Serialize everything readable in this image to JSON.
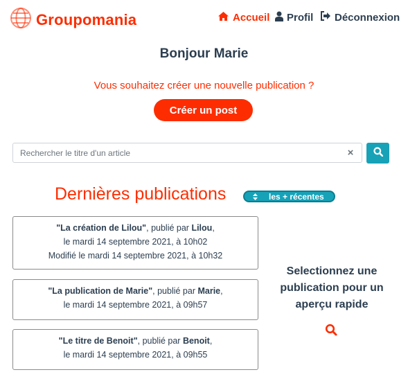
{
  "header": {
    "brand": "Groupomania",
    "nav": [
      {
        "label": "Accueil",
        "icon": "home-icon"
      },
      {
        "label": "Profil",
        "icon": "user-icon"
      },
      {
        "label": "Déconnexion",
        "icon": "logout-icon"
      }
    ]
  },
  "greeting": "Bonjour Marie",
  "create": {
    "prompt": "Vous souhaitez créer une nouvelle publication ?",
    "button_label": "Créer un post"
  },
  "search": {
    "placeholder": "Rechercher le titre d'un article",
    "value": "",
    "clear_label": "×"
  },
  "publications": {
    "title": "Dernières publications",
    "sort_label": "les + récentes",
    "posts": [
      {
        "title": "\"La création de Lilou\"",
        "published_by": ", publié par ",
        "author": "Lilou",
        "author_suffix": ",",
        "date_line": "le mardi 14 septembre 2021, à 10h02",
        "modified_line": "Modifié le mardi 14 septembre 2021, à 10h32"
      },
      {
        "title": "\"La publication de Marie\"",
        "published_by": ", publié par ",
        "author": "Marie",
        "author_suffix": ",",
        "date_line": "le mardi 14 septembre 2021, à 09h57"
      },
      {
        "title": "\"Le titre de Benoit\"",
        "published_by": ", publié par ",
        "author": "Benoit",
        "author_suffix": ",",
        "date_line": "le mardi 14 septembre 2021, à 09h55"
      }
    ]
  },
  "preview": {
    "text": "Selectionnez une publication pour un aperçu rapide",
    "icon": "search-icon"
  },
  "colors": {
    "brand_red": "#fd2d01",
    "dark_text": "#2c3e50",
    "teal": "#17a2b8"
  }
}
